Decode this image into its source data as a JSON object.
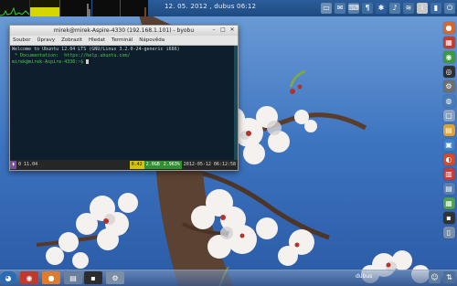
{
  "panel": {
    "clock": "12. 05. 2012 , dubus 06:12",
    "tray_icons": [
      {
        "name": "screen-icon",
        "glyph": "▭",
        "color": "#6d8fb4"
      },
      {
        "name": "mail-icon",
        "glyph": "✉",
        "color": "#4a76a8"
      },
      {
        "name": "keyboard-icon",
        "glyph": "⌨",
        "color": "#5a7fa8"
      },
      {
        "name": "clipboard-icon",
        "glyph": "¶",
        "color": "#3e6da0"
      },
      {
        "name": "bluetooth-icon",
        "glyph": "✱",
        "color": "#2d5f9d"
      },
      {
        "name": "volume-icon",
        "glyph": "♪",
        "color": "#4e7ca8"
      },
      {
        "name": "wifi-icon",
        "glyph": "≋",
        "color": "#3f6e9f"
      },
      {
        "name": "info-icon",
        "glyph": "i",
        "color": "#c8c8c8"
      },
      {
        "name": "battery-icon",
        "glyph": "▮",
        "color": "#3e6ea5"
      },
      {
        "name": "power-icon",
        "glyph": "⏻",
        "color": "#4b79aa"
      }
    ]
  },
  "monitors": {
    "mem_fill": 0.55
  },
  "right_dock": [
    {
      "name": "firefox-icon",
      "glyph": "●",
      "color": "#d9662b"
    },
    {
      "name": "app-launcher-icon",
      "glyph": "▦",
      "color": "#c43c2a"
    },
    {
      "name": "chrome-icon",
      "glyph": "◉",
      "color": "#3c9b3c"
    },
    {
      "name": "media-icon",
      "glyph": "◎",
      "color": "#2f2f2f"
    },
    {
      "name": "settings-icon",
      "glyph": "⚙",
      "color": "#6f6f6f"
    },
    {
      "name": "globe-icon",
      "glyph": "◍",
      "color": "#4b7cb6"
    },
    {
      "name": "chat-icon",
      "glyph": "▢",
      "color": "#8aa2c0"
    },
    {
      "name": "notes-icon",
      "glyph": "▤",
      "color": "#e0a230"
    },
    {
      "name": "calendar-icon",
      "glyph": "▣",
      "color": "#3d82c8"
    },
    {
      "name": "software-center-icon",
      "glyph": "◐",
      "color": "#d24a2a"
    },
    {
      "name": "files-icon",
      "glyph": "▥",
      "color": "#c83a3a"
    },
    {
      "name": "documents-icon",
      "glyph": "▤",
      "color": "#5b7fb0"
    },
    {
      "name": "spreadsheet-icon",
      "glyph": "▦",
      "color": "#4fa04f"
    },
    {
      "name": "terminal-icon",
      "glyph": "▪",
      "color": "#333333"
    },
    {
      "name": "trash-icon",
      "glyph": "▯",
      "color": "#7a8ea8"
    }
  ],
  "terminal": {
    "title": "mirek@mirek-Aspire-4330 (192.168.1.101) - byobu",
    "menu": [
      "Soubor",
      "Úpravy",
      "Zobrazit",
      "Hledat",
      "Terminál",
      "Nápověda"
    ],
    "lines": [
      "Welcome to Ubuntu 12.04 LTS (GNU/Linux 3.2.0-24-generic i686)",
      "",
      " * Documentation:  https://help.ubuntu.com/",
      "mirek@mirek-Aspire-4330:~$ "
    ],
    "status": {
      "window": "0 11.04",
      "load": "0.42",
      "mem": "2.0GB",
      "cpu": "2.963%",
      "datetime": "2012-05-12 06:12:58"
    }
  },
  "taskbar": {
    "label": "dubus",
    "items": [
      {
        "name": "start-menu-icon",
        "glyph": "◕",
        "color": "#2b6cb0"
      },
      {
        "name": "chrome-task-icon",
        "glyph": "◉",
        "color": "#c0392b"
      },
      {
        "name": "firefox-task-icon",
        "glyph": "●",
        "color": "#e07b2b"
      },
      {
        "name": "files-task-icon",
        "glyph": "▤",
        "color": "#6a7f9a"
      },
      {
        "name": "terminal-task-icon",
        "glyph": "▪",
        "color": "#2c2c2c"
      },
      {
        "name": "settings-task-icon",
        "glyph": "⚙",
        "color": "#7b8ea5"
      }
    ],
    "tray": [
      {
        "name": "user-icon",
        "glyph": "☺",
        "color": "#5e7c9e"
      },
      {
        "name": "network-icon",
        "glyph": "⇅",
        "color": "#4c6f96"
      }
    ]
  }
}
